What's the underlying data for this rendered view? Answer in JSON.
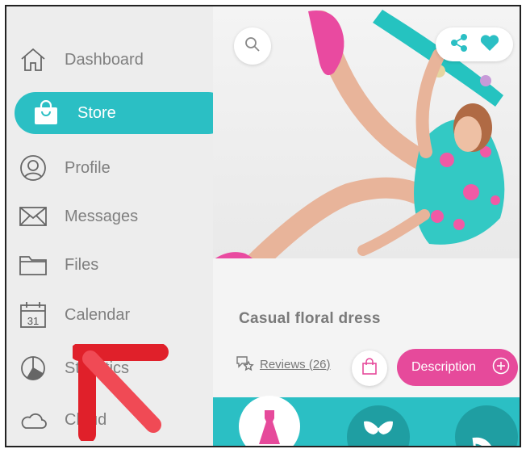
{
  "sidebar": {
    "items": [
      {
        "label": "Dashboard",
        "icon": "home-icon"
      },
      {
        "label": "Store",
        "icon": "shopping-bag-icon"
      },
      {
        "label": "Profile",
        "icon": "user-icon"
      },
      {
        "label": "Messages",
        "icon": "envelope-icon"
      },
      {
        "label": "Files",
        "icon": "folder-icon"
      },
      {
        "label": "Calendar",
        "icon": "calendar-icon",
        "calendar_day": "31"
      },
      {
        "label": "Statistics",
        "icon": "pie-chart-icon"
      },
      {
        "label": "Cloud",
        "icon": "cloud-icon"
      }
    ],
    "active_index": 1
  },
  "product": {
    "title": "Casual floral dress",
    "reviews_label": "Reviews (26)",
    "description_label": "Description"
  },
  "categories": [
    {
      "icon": "dress-icon",
      "active": true
    },
    {
      "icon": "bra-icon",
      "active": false
    },
    {
      "icon": "heel-shoe-icon",
      "active": false
    }
  ],
  "colors": {
    "accent": "#2bbfc4",
    "pink": "#e64a9b",
    "sidebar_bg": "#ededed",
    "annotation_arrow": "#e0202a"
  }
}
